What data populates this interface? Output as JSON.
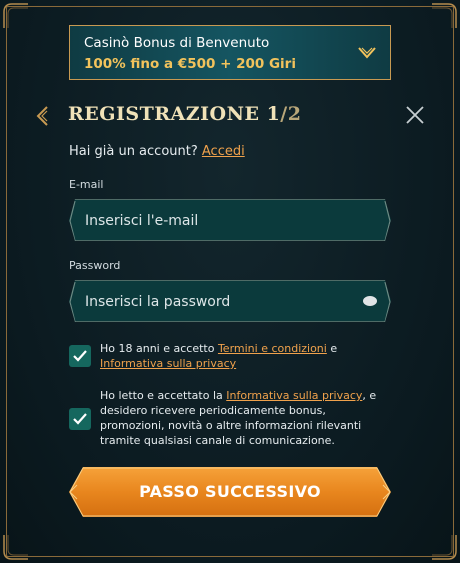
{
  "bonus": {
    "title": "Casinò Bonus di Benvenuto",
    "offer": "100% fino a €500 + 200 Giri"
  },
  "header": {
    "title": "REGISTRAZIONE ",
    "step": "1",
    "step_total": "/2"
  },
  "account": {
    "prompt": "Hai già un account? ",
    "login_label": "Accedi"
  },
  "email": {
    "label": "E-mail",
    "placeholder": "Inserisci l'e-mail",
    "value": ""
  },
  "password": {
    "label": "Password",
    "placeholder": "Inserisci la password",
    "value": ""
  },
  "consent_age": {
    "checked": true,
    "text_1": "Ho 18 anni e accetto ",
    "terms_link": "Termini e condizioni",
    "text_2": " e ",
    "privacy_link": "Informativa sulla privacy"
  },
  "consent_marketing": {
    "checked": true,
    "text_1": "Ho letto e accettato la ",
    "privacy_link": "Informativa sulla privacy",
    "text_2": ", e desidero ricevere periodicamente bonus, promozioni, novità o altre informazioni rilevanti tramite qualsiasi canale di comunicazione."
  },
  "submit": {
    "label": "PASSO SUCCESSIVO"
  },
  "colors": {
    "background": "#0d1c22",
    "gold": "#c89a52",
    "accent_orange": "#f0a24c",
    "field_bg": "#0b3a3c",
    "checkbox": "#15675e"
  },
  "icons": {
    "back": "chevron-left-icon",
    "close": "close-icon",
    "dropdown": "chevron-down-icon",
    "password_toggle": "eye-icon",
    "checkmark": "check-icon"
  }
}
